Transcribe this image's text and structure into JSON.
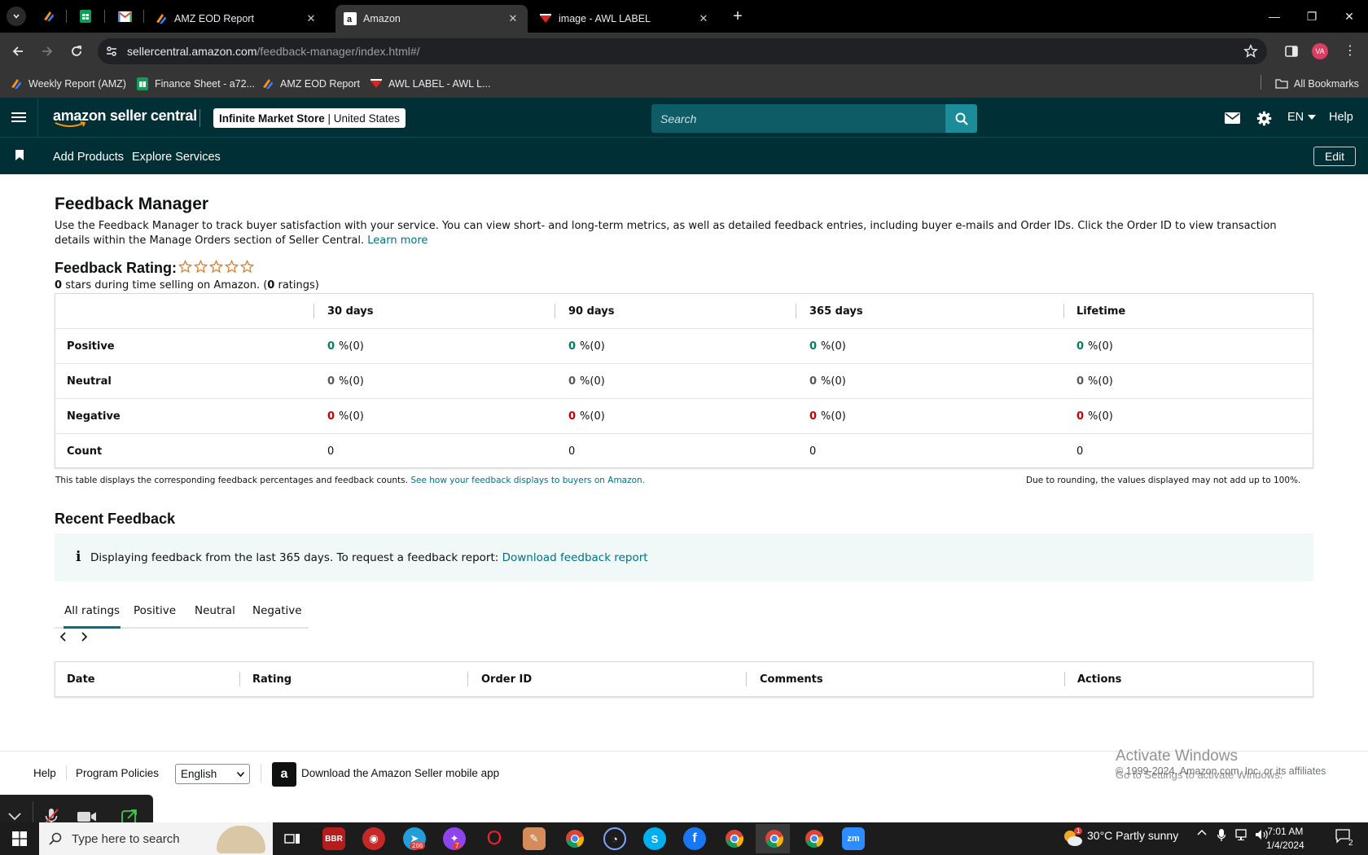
{
  "browser": {
    "tabs": [
      {
        "title": "AMZ EOD Report"
      },
      {
        "title": "Amazon"
      },
      {
        "title": "image - AWL LABEL"
      }
    ],
    "url_host": "sellercentral.amazon.com",
    "url_path": "/feedback-manager/index.html#/",
    "profile_initials": "VA",
    "bookmarks": [
      {
        "label": "Weekly Report (AMZ)"
      },
      {
        "label": "Finance Sheet - a72..."
      },
      {
        "label": "AMZ EOD Report"
      },
      {
        "label": "AWL LABEL - AWL L..."
      }
    ],
    "all_bookmarks": "All Bookmarks"
  },
  "header": {
    "logo": "amazon seller central",
    "store_name": "Infinite Market Store",
    "store_region": "United States",
    "search_placeholder": "Search",
    "language": "EN",
    "help": "Help",
    "nav": [
      "Add Products",
      "Explore Services"
    ],
    "edit": "Edit"
  },
  "page": {
    "title": "Feedback Manager",
    "intro": "Use the Feedback Manager to track buyer satisfaction with your service. You can view short- and long-term metrics, as well as detailed feedback entries, including buyer e-mails and Order IDs. Click the Order ID to view transaction details within the Manage Orders section of Seller Central.",
    "learn_more": "Learn more",
    "rating_label": "Feedback Rating:",
    "stars_value": "0",
    "stars_text": "stars during time selling on Amazon. (",
    "ratings_count": "0",
    "ratings_suffix": "ratings)",
    "star_rating_level": 0
  },
  "metrics": {
    "columns": [
      "30 days",
      "90 days",
      "365 days",
      "Lifetime"
    ],
    "rows": [
      {
        "label": "Positive",
        "cells": [
          {
            "v": "0",
            "p": "%(0)"
          },
          {
            "v": "0",
            "p": "%(0)"
          },
          {
            "v": "0",
            "p": "%(0)"
          },
          {
            "v": "0",
            "p": "%(0)"
          }
        ]
      },
      {
        "label": "Neutral",
        "cells": [
          {
            "v": "0",
            "p": "%(0)"
          },
          {
            "v": "0",
            "p": "%(0)"
          },
          {
            "v": "0",
            "p": "%(0)"
          },
          {
            "v": "0",
            "p": "%(0)"
          }
        ]
      },
      {
        "label": "Negative",
        "cells": [
          {
            "v": "0",
            "p": "%(0)"
          },
          {
            "v": "0",
            "p": "%(0)"
          },
          {
            "v": "0",
            "p": "%(0)"
          },
          {
            "v": "0",
            "p": "%(0)"
          }
        ]
      },
      {
        "label": "Count",
        "counts": [
          "0",
          "0",
          "0",
          "0"
        ]
      }
    ],
    "note": "This table displays the corresponding feedback percentages and feedback counts.",
    "note_link": "See how your feedback displays to buyers on Amazon.",
    "rounding_note": "Due to rounding, the values displayed may not add up to 100%.",
    "colors": {
      "positive": "#067d62",
      "neutral": "#565959",
      "negative": "#c40000"
    }
  },
  "recent": {
    "title": "Recent Feedback",
    "info_text": "Displaying feedback from the last 365 days. To request a feedback report:",
    "info_link": "Download feedback report",
    "tabs": [
      "All ratings",
      "Positive",
      "Neutral",
      "Negative"
    ],
    "columns": [
      "Date",
      "Rating",
      "Order ID",
      "Comments",
      "Actions"
    ]
  },
  "footer": {
    "help": "Help",
    "policies": "Program Policies",
    "language": "English",
    "app": "Download the Amazon Seller mobile app",
    "copyright": "© 1999-2024, Amazon.com, Inc. or its affiliates",
    "activate_title": "Activate Windows",
    "activate_sub": "Go to Settings to activate Windows."
  },
  "taskbar": {
    "search_placeholder": "Type here to search",
    "weather": "30°C  Partly sunny",
    "time": "7:01 AM",
    "date": "1/4/2024",
    "telegram_badge": "266",
    "messenger_badge": "7",
    "notifications": "2",
    "weather_badge": "1"
  },
  "colors": {
    "accent": "#007185",
    "header_bg": "#002f36"
  }
}
